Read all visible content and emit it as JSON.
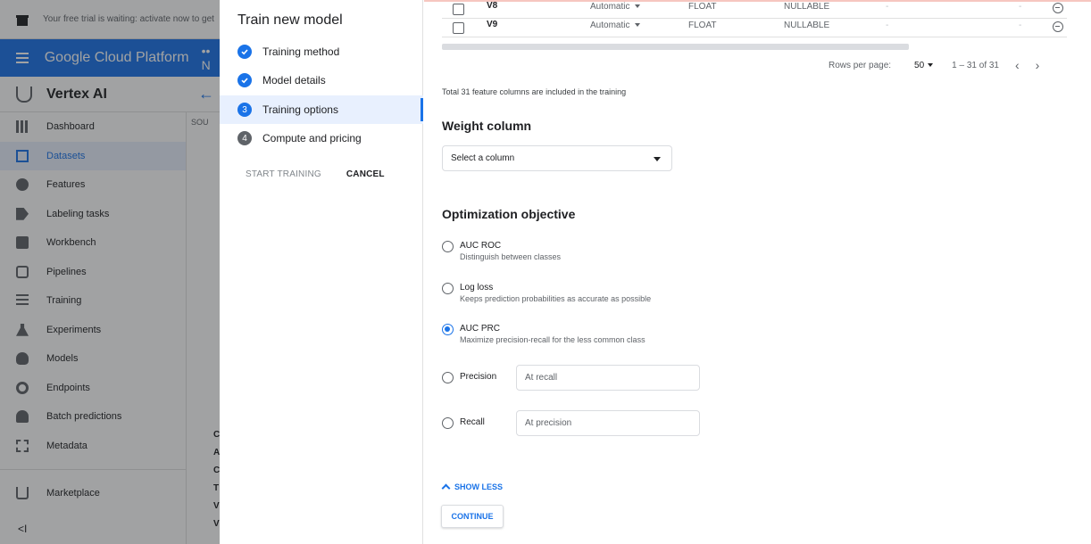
{
  "background": {
    "trial_text": "Your free trial is waiting: activate now to get",
    "brand": "Google Cloud Platform",
    "project_glyph": "•• N",
    "product": "Vertex AI",
    "source_tab": "SOU",
    "nav": [
      {
        "label": "Dashboard",
        "icon": "dashboard-icon"
      },
      {
        "label": "Datasets",
        "icon": "datasets-icon",
        "active": true
      },
      {
        "label": "Features",
        "icon": "features-icon"
      },
      {
        "label": "Labeling tasks",
        "icon": "labeling-tasks-icon"
      },
      {
        "label": "Workbench",
        "icon": "workbench-icon"
      },
      {
        "label": "Pipelines",
        "icon": "pipelines-icon"
      },
      {
        "label": "Training",
        "icon": "training-icon"
      },
      {
        "label": "Experiments",
        "icon": "experiments-icon"
      },
      {
        "label": "Models",
        "icon": "models-icon"
      },
      {
        "label": "Endpoints",
        "icon": "endpoints-icon"
      },
      {
        "label": "Batch predictions",
        "icon": "batch-predictions-icon"
      },
      {
        "label": "Metadata",
        "icon": "metadata-icon"
      }
    ],
    "marketplace": "Marketplace",
    "collapse_glyph": "<I",
    "partial_letters": [
      "C",
      "A",
      "C",
      "T",
      "V",
      "V"
    ]
  },
  "steps_panel": {
    "title": "Train new model",
    "steps": [
      {
        "label": "Training method",
        "state": "done",
        "number": ""
      },
      {
        "label": "Model details",
        "state": "done",
        "number": ""
      },
      {
        "label": "Training options",
        "state": "current",
        "number": "3"
      },
      {
        "label": "Compute and pricing",
        "state": "todo",
        "number": "4"
      }
    ],
    "start_training": "START TRAINING",
    "cancel": "CANCEL"
  },
  "table": {
    "rows": [
      {
        "name": "V8",
        "transformation": "Automatic",
        "type": "FLOAT",
        "nullable": "NULLABLE",
        "d1": "-",
        "d2": "-"
      },
      {
        "name": "V9",
        "transformation": "Automatic",
        "type": "FLOAT",
        "nullable": "NULLABLE",
        "d1": "-",
        "d2": "-"
      }
    ],
    "rows_per_page_label": "Rows per page:",
    "rows_per_page_value": "50",
    "range": "1 – 31 of 31",
    "prev": "‹",
    "next": "›"
  },
  "total_note": "Total 31 feature columns are included in the training",
  "weight_column": {
    "title": "Weight column",
    "placeholder": "Select a column"
  },
  "optimization": {
    "title": "Optimization objective",
    "options": [
      {
        "label": "AUC ROC",
        "description": "Distinguish between classes",
        "checked": false
      },
      {
        "label": "Log loss",
        "description": "Keeps prediction probabilities as accurate as possible",
        "checked": false
      },
      {
        "label": "AUC PRC",
        "description": "Maximize precision-recall for the less common class",
        "checked": true
      },
      {
        "label": "Precision",
        "field_placeholder": "At recall",
        "checked": false
      },
      {
        "label": "Recall",
        "field_placeholder": "At precision",
        "checked": false
      }
    ]
  },
  "show_less": "SHOW LESS",
  "continue": "CONTINUE",
  "colors": {
    "accent": "#1a73e8",
    "brand_bar": "#1a73e8",
    "active_bg": "#e8f0fe"
  }
}
